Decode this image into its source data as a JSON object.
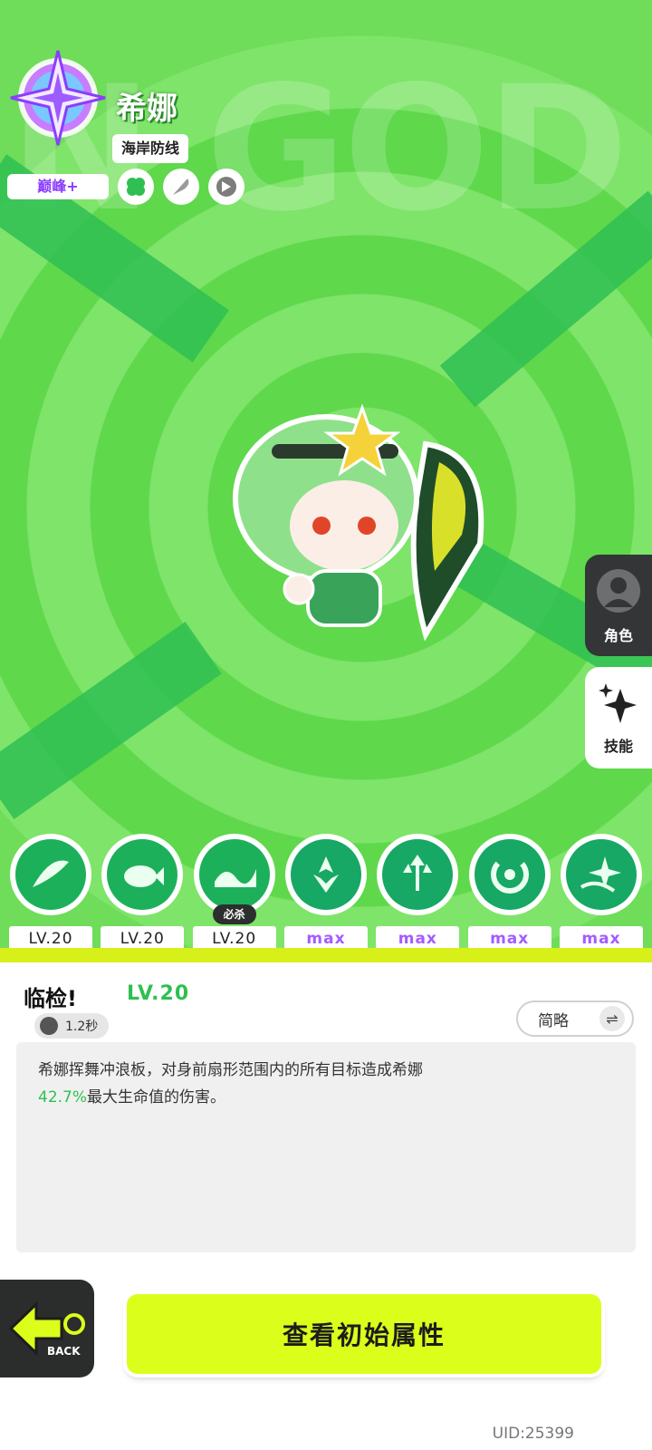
{
  "character": {
    "name": "希娜",
    "subtitle": "海岸防线",
    "rank": "巅峰+",
    "bg_word": "N GOD"
  },
  "traits": [
    {
      "icon": "clover-icon"
    },
    {
      "icon": "feather-icon"
    },
    {
      "icon": "crest-icon"
    }
  ],
  "side_menu": {
    "role_label": "角色",
    "skill_label": "技能"
  },
  "skills": [
    {
      "icon": "skill-surf-icon",
      "level": "LV.20",
      "max": false
    },
    {
      "icon": "skill-fish-icon",
      "level": "LV.20",
      "max": false
    },
    {
      "icon": "skill-wave-icon",
      "level": "LV.20",
      "max": false,
      "tag": "必杀"
    },
    {
      "icon": "skill-split-icon",
      "level": "max",
      "max": true
    },
    {
      "icon": "skill-arrows-icon",
      "level": "max",
      "max": true
    },
    {
      "icon": "skill-swirl-icon",
      "level": "max",
      "max": true
    },
    {
      "icon": "skill-star-icon",
      "level": "max",
      "max": true
    }
  ],
  "detail": {
    "title": "临检!",
    "level": "LV.20",
    "cooldown": "1.2秒",
    "toggle_label": "简略",
    "description_part1": "希娜挥舞冲浪板，对身前扇形范围内的所有目标造成希娜",
    "description_highlight": "42.7%",
    "description_part2": "最大生命值的伤害。"
  },
  "footer": {
    "back_label": "BACK",
    "main_button": "查看初始属性",
    "uid": "UID:25399"
  },
  "colors": {
    "accent_green": "#2fbf52",
    "lime": "#dbff1a",
    "max_purple": "#a35cff"
  }
}
